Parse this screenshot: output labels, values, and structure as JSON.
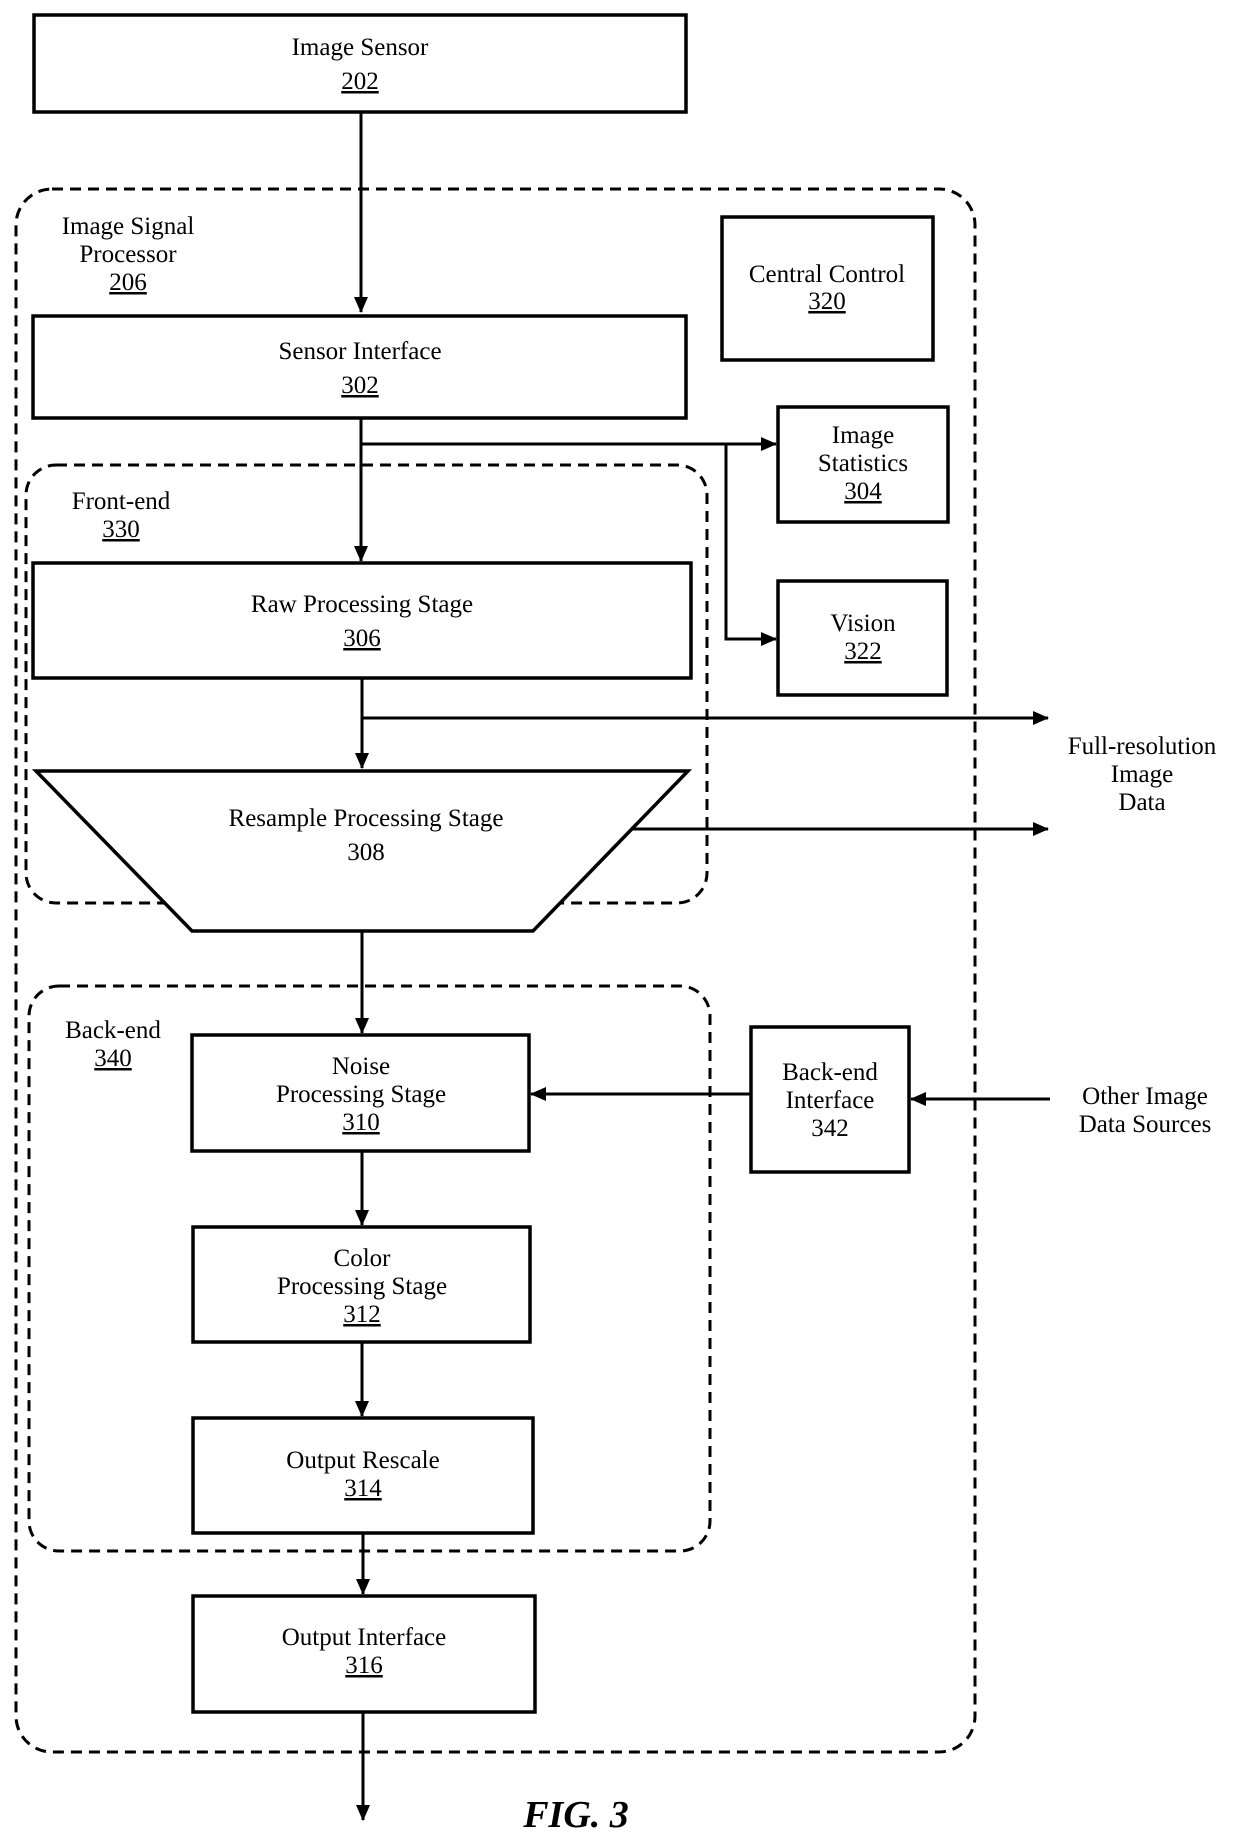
{
  "figure": {
    "caption": "FIG. 3",
    "background_color": "#ffffff",
    "stroke_color": "#000000"
  },
  "containers": {
    "isp": {
      "line1": "Image Signal",
      "line2": "Processor",
      "ref": "206"
    },
    "front_end": {
      "line1": "Front-end",
      "ref": "330"
    },
    "back_end": {
      "line1": "Back-end",
      "ref": "340"
    }
  },
  "blocks": {
    "image_sensor": {
      "line1": "Image Sensor",
      "ref": "202"
    },
    "sensor_interface": {
      "line1": "Sensor Interface",
      "ref": "302"
    },
    "central_control": {
      "line1": "Central Control",
      "ref": "320"
    },
    "image_statistics": {
      "line1": "Image",
      "line2": "Statistics",
      "ref": "304"
    },
    "vision": {
      "line1": "Vision",
      "ref": "322"
    },
    "raw_processing": {
      "line1": "Raw Processing Stage",
      "ref": "306"
    },
    "resample_processing": {
      "line1": "Resample Processing Stage",
      "ref": "308"
    },
    "noise_processing": {
      "line1": "Noise",
      "line2": "Processing Stage",
      "ref": "310"
    },
    "color_processing": {
      "line1": "Color",
      "line2": "Processing Stage",
      "ref": "312"
    },
    "output_rescale": {
      "line1": "Output Rescale",
      "ref": "314"
    },
    "output_interface": {
      "line1": "Output Interface",
      "ref": "316"
    },
    "back_end_interface": {
      "line1": "Back-end",
      "line2": "Interface",
      "ref": "342"
    }
  },
  "external_labels": {
    "full_resolution": {
      "line1": "Full-resolution",
      "line2": "Image",
      "line3": "Data"
    },
    "other_sources": {
      "line1": "Other Image",
      "line2": "Data Sources"
    }
  }
}
